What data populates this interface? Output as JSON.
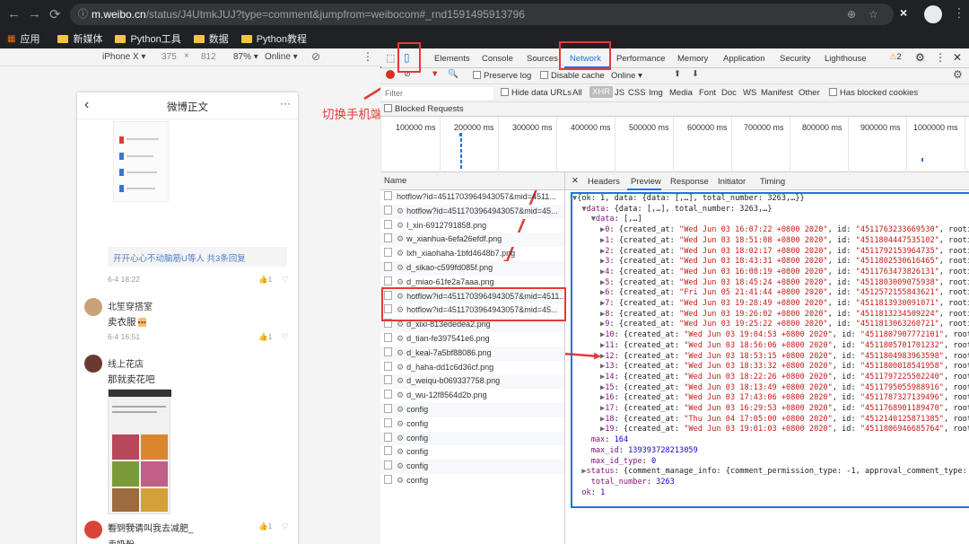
{
  "browser": {
    "url_host": "m.weibo.cn",
    "url_path": "/status/J4UtmkJUJ?type=comment&jumpfrom=weibocom#_rnd1591495913796",
    "bookmarks": [
      "应用",
      "新媒体",
      "Python工具",
      "数据",
      "Python教程"
    ]
  },
  "device_toolbar": {
    "device": "iPhone X",
    "width": "375",
    "x": "×",
    "height": "812",
    "zoom": "87%",
    "throttle": "Online"
  },
  "phone": {
    "title": "微博正文",
    "reply_link": "开开心心不动脑筋U等人  共3条回复",
    "reply_time": "6-4 18:22",
    "likes": "1",
    "comments": [
      {
        "name": "北笙穿搭室",
        "text": "卖衣服",
        "time": "6-4 16:51",
        "likes": "1"
      },
      {
        "name": "线上花店",
        "text": "那就卖花吧",
        "time": "6-3 18:52",
        "likes": "1"
      },
      {
        "name": "看到我请叫我去减肥_",
        "text": "卖奶粉",
        "time": "",
        "likes": ""
      }
    ]
  },
  "annotation": {
    "label": "切换手机端"
  },
  "devtools": {
    "tabs": [
      "Elements",
      "Console",
      "Sources",
      "Network",
      "Performance",
      "Memory",
      "Application",
      "Security",
      "Lighthouse"
    ],
    "warn_count": "2",
    "toolbar": {
      "preserve_log": "Preserve log",
      "disable_cache": "Disable cache",
      "online": "Online"
    },
    "filter_placeholder": "Filter",
    "hide_data_urls": "Hide data URLs",
    "filter_types": [
      "All",
      "XHR",
      "JS",
      "CSS",
      "Img",
      "Media",
      "Font",
      "Doc",
      "WS",
      "Manifest",
      "Other"
    ],
    "has_blocked": "Has blocked cookies",
    "blocked_requests": "Blocked Requests",
    "timeline_ticks": [
      "100000 ms",
      "200000 ms",
      "300000 ms",
      "400000 ms",
      "500000 ms",
      "600000 ms",
      "700000 ms",
      "800000 ms",
      "900000 ms",
      "1000000 ms"
    ],
    "name_header": "Name",
    "requests": [
      "hotflow?id=4511703964943057&mid=4511...",
      "hotflow?id=4511703964943057&mid=45...",
      "l_xin-6912791858.png",
      "w_xianhua-6efa26efdf.png",
      "lxh_xiaohaha-1bfd4648b7.png",
      "d_sikao-c599fd085f.png",
      "d_miao-61fe2a7aaa.png",
      "hotflow?id=4511703964943057&mid=4511...",
      "hotflow?id=4511703964943057&mid=45...",
      "d_xixi-813ededea2.png",
      "d_tian-fe397541e6.png",
      "d_keai-7a5bf88086.png",
      "d_haha-dd1c6d36cf.png",
      "d_weiqu-b069337758.png",
      "d_wu-12f8564d2b.png",
      "config",
      "config",
      "config",
      "config",
      "config",
      "config"
    ],
    "preview_tabs": [
      "Headers",
      "Preview",
      "Response",
      "Initiator",
      "Timing"
    ],
    "preview": {
      "root": "{ok: 1, data: {data: [,…], total_number: 3263,…}}",
      "data": "data: {data: [,…], total_number: 3263,…}",
      "data_arr": "data: [,…]",
      "rows": [
        [
          "0",
          "Wed Jun 03 16:07:22 +0800 2020",
          "4511763233669530"
        ],
        [
          "1",
          "Wed Jun 03 18:51:08 +0800 2020",
          "4511804447535102"
        ],
        [
          "2",
          "Wed Jun 03 18:02:17 +0800 2020",
          "4511792153964735"
        ],
        [
          "3",
          "Wed Jun 03 18:43:31 +0800 2020",
          "4511802530616465"
        ],
        [
          "4",
          "Wed Jun 03 16:08:19 +0800 2020",
          "4511763473826131"
        ],
        [
          "5",
          "Wed Jun 03 18:45:24 +0800 2020",
          "4511803009075938"
        ],
        [
          "6",
          "Fri Jun 05 21:41:44 +0800 2020",
          "4512572155843621"
        ],
        [
          "7",
          "Wed Jun 03 19:28:49 +0800 2020",
          "4511813930091071"
        ],
        [
          "8",
          "Wed Jun 03 19:26:02 +0800 2020",
          "4511813234509224"
        ],
        [
          "9",
          "Wed Jun 03 19:25:22 +0800 2020",
          "4511813063260721"
        ],
        [
          "10",
          "Wed Jun 03 19:04:53 +0800 2020",
          "4511807907772101"
        ],
        [
          "11",
          "Wed Jun 03 18:56:06 +0800 2020",
          "4511805701701232"
        ],
        [
          "12",
          "Wed Jun 03 18:53:15 +0800 2020",
          "4511804983963598"
        ],
        [
          "13",
          "Wed Jun 03 18:33:32 +0800 2020",
          "4511800018541958"
        ],
        [
          "14",
          "Wed Jun 03 18:22:26 +0800 2020",
          "4511797225502240"
        ],
        [
          "15",
          "Wed Jun 03 18:13:49 +0800 2020",
          "4511795055988916"
        ],
        [
          "16",
          "Wed Jun 03 17:43:06 +0800 2020",
          "4511787327139496"
        ],
        [
          "17",
          "Wed Jun 03 16:29:53 +0800 2020",
          "4511768901189470"
        ],
        [
          "18",
          "Thu Jun 04 17:05:00 +0800 2020",
          "4512140125871385"
        ],
        [
          "19",
          "Wed Jun 03 19:01:03 +0800 2020",
          "4511806946685764"
        ]
      ],
      "max": "164",
      "max_id": "139393728213059",
      "max_id_type": "0",
      "status": "status: {comment_manage_info: {comment_permission_type: -1, approval_comment_type: 0}",
      "total_number": "3263",
      "ok": "1"
    }
  },
  "colors": {
    "highlight": "#e53935",
    "selection": "#1a73e8"
  }
}
